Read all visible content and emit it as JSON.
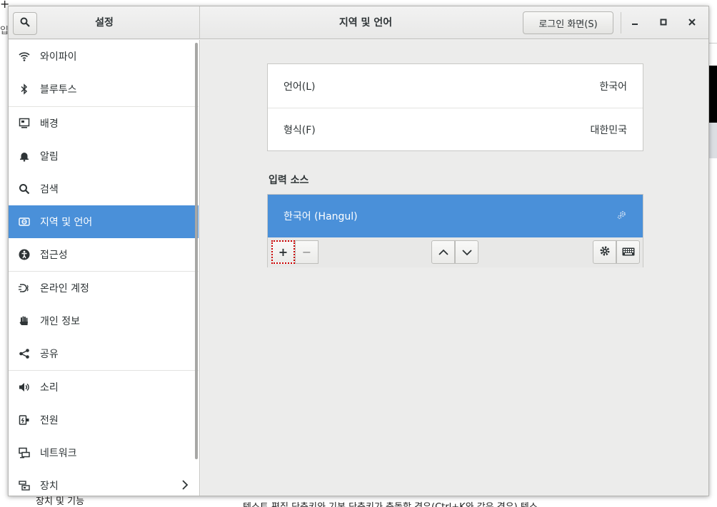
{
  "background": {
    "top_left_symbol": "+",
    "left_fragment": "입",
    "bottom_text": "텍스트 편집 단축키와 기본 단축키가 충돌할 경우(Ctrl+K와 같은 경우) 텍스",
    "bottom_left_text": "장치 및 기능"
  },
  "titlebar": {
    "settings_title": "설정",
    "page_title": "지역 및 언어",
    "login_button": "로그인 화면(S)",
    "minimize": "—",
    "maximize": "▫",
    "close": "✕"
  },
  "sidebar": {
    "items": [
      {
        "label": "와이파이",
        "icon": "wifi-icon"
      },
      {
        "label": "블루투스",
        "icon": "bluetooth-icon"
      },
      {
        "label": "배경",
        "icon": "background-icon"
      },
      {
        "label": "알림",
        "icon": "bell-icon"
      },
      {
        "label": "검색",
        "icon": "search-icon"
      },
      {
        "label": "지역 및 언어",
        "icon": "region-icon"
      },
      {
        "label": "접근성",
        "icon": "accessibility-icon"
      },
      {
        "label": "온라인 계정",
        "icon": "online-accounts-icon"
      },
      {
        "label": "개인 정보",
        "icon": "privacy-hand-icon"
      },
      {
        "label": "공유",
        "icon": "share-icon"
      },
      {
        "label": "소리",
        "icon": "speaker-icon"
      },
      {
        "label": "전원",
        "icon": "power-icon"
      },
      {
        "label": "네트워크",
        "icon": "network-icon"
      },
      {
        "label": "장치",
        "icon": "devices-icon"
      }
    ],
    "active_index": 5
  },
  "content": {
    "language_label": "언어(L)",
    "language_value": "한국어",
    "format_label": "형식(F)",
    "format_value": "대한민국",
    "input_sources_title": "입력 소스",
    "input_source_item": "한국어 (Hangul)",
    "add_button": "+",
    "remove_button": "−"
  },
  "colors": {
    "accent": "#4a90d9",
    "focus_outline": "#cc0000"
  }
}
